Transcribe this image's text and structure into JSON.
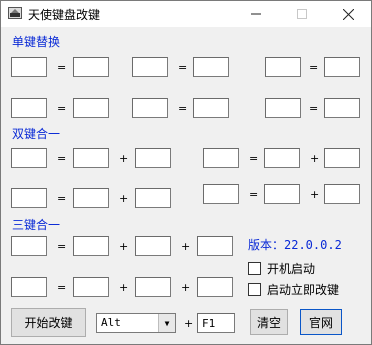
{
  "window": {
    "title": "天使键盘改键"
  },
  "sections": {
    "single": "单键替换",
    "double": "双键合一",
    "triple": "三键合一"
  },
  "ops": {
    "eq": "=",
    "plus": "+"
  },
  "version": "版本：22.0.0.2",
  "checkboxes": {
    "autostart": "开机启动",
    "immediate": "启动立即改键"
  },
  "buttons": {
    "start": "开始改键",
    "clear": "清空",
    "website": "官网"
  },
  "hotkey": {
    "modifier": "Alt",
    "key": "F1"
  }
}
